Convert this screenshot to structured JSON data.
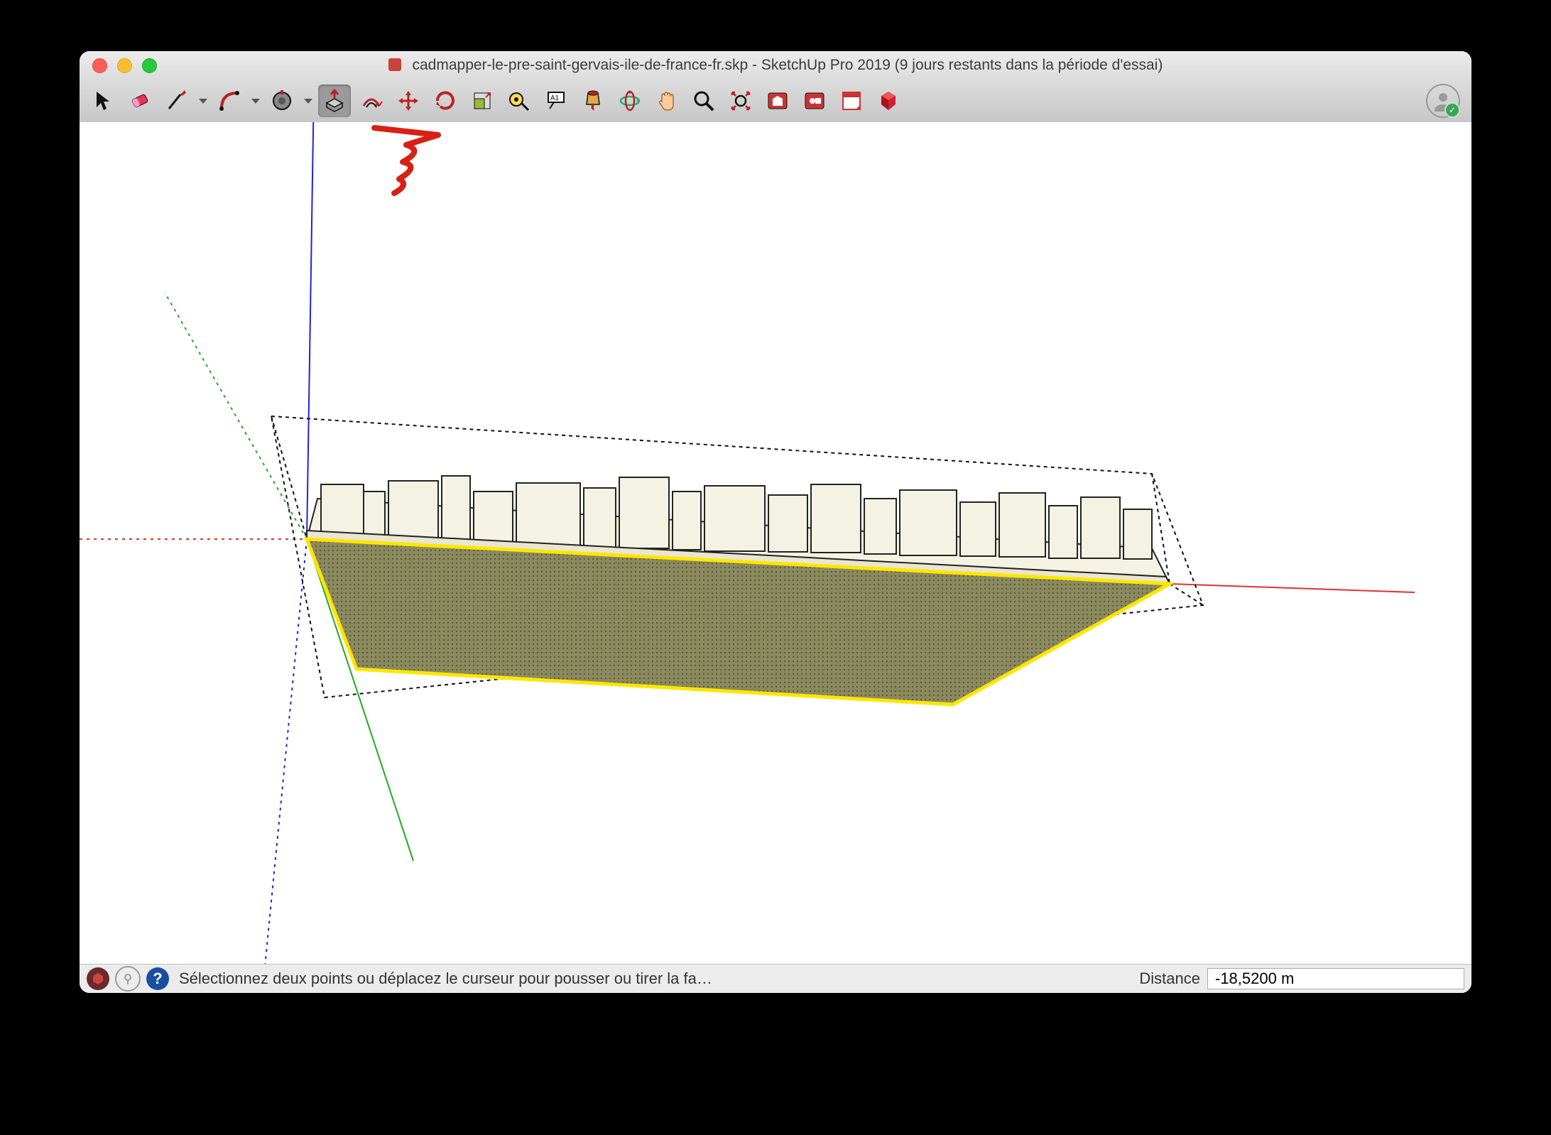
{
  "window": {
    "title_file": "cadmapper-le-pre-saint-gervais-ile-de-france-fr.skp",
    "title_app": "SketchUp Pro 2019 (9 jours restants dans la période d'essai)"
  },
  "toolbar": {
    "tools": [
      {
        "name": "select-tool",
        "icon": "cursor",
        "dropdown": false
      },
      {
        "name": "eraser-tool",
        "icon": "eraser",
        "dropdown": false
      },
      {
        "name": "line-tool",
        "icon": "pencil",
        "dropdown": true
      },
      {
        "name": "arc-tool",
        "icon": "arc",
        "dropdown": true
      },
      {
        "name": "shape-tool",
        "icon": "rectangle",
        "dropdown": true
      },
      {
        "name": "pushpull-tool",
        "icon": "pushpull",
        "dropdown": false,
        "selected": true
      },
      {
        "name": "offset-tool",
        "icon": "offset",
        "dropdown": false
      },
      {
        "name": "move-tool",
        "icon": "move",
        "dropdown": false
      },
      {
        "name": "rotate-tool",
        "icon": "rotate",
        "dropdown": false
      },
      {
        "name": "scale-tool",
        "icon": "scale",
        "dropdown": false
      },
      {
        "name": "tape-tool",
        "icon": "tape",
        "dropdown": false
      },
      {
        "name": "text-tool",
        "icon": "text",
        "dropdown": false
      },
      {
        "name": "paint-tool",
        "icon": "paint",
        "dropdown": false
      },
      {
        "name": "orbit-tool",
        "icon": "orbit",
        "dropdown": false
      },
      {
        "name": "pan-tool",
        "icon": "pan",
        "dropdown": false
      },
      {
        "name": "zoom-tool",
        "icon": "zoom",
        "dropdown": false
      },
      {
        "name": "zoom-extents-tool",
        "icon": "zoomext",
        "dropdown": false
      },
      {
        "name": "warehouse-tool",
        "icon": "warehouse",
        "dropdown": false
      },
      {
        "name": "extension-warehouse-tool",
        "icon": "extwarehouse",
        "dropdown": false
      },
      {
        "name": "layout-tool",
        "icon": "layout",
        "dropdown": false
      },
      {
        "name": "extensions-tool",
        "icon": "ruby",
        "dropdown": false
      }
    ]
  },
  "statusbar": {
    "hint": "Sélectionnez deux points ou déplacez le curseur pour pousser ou tirer la fa…",
    "measurement_label": "Distance",
    "measurement_value": "-18,5200 m"
  },
  "user": {
    "status": "signed-in"
  }
}
